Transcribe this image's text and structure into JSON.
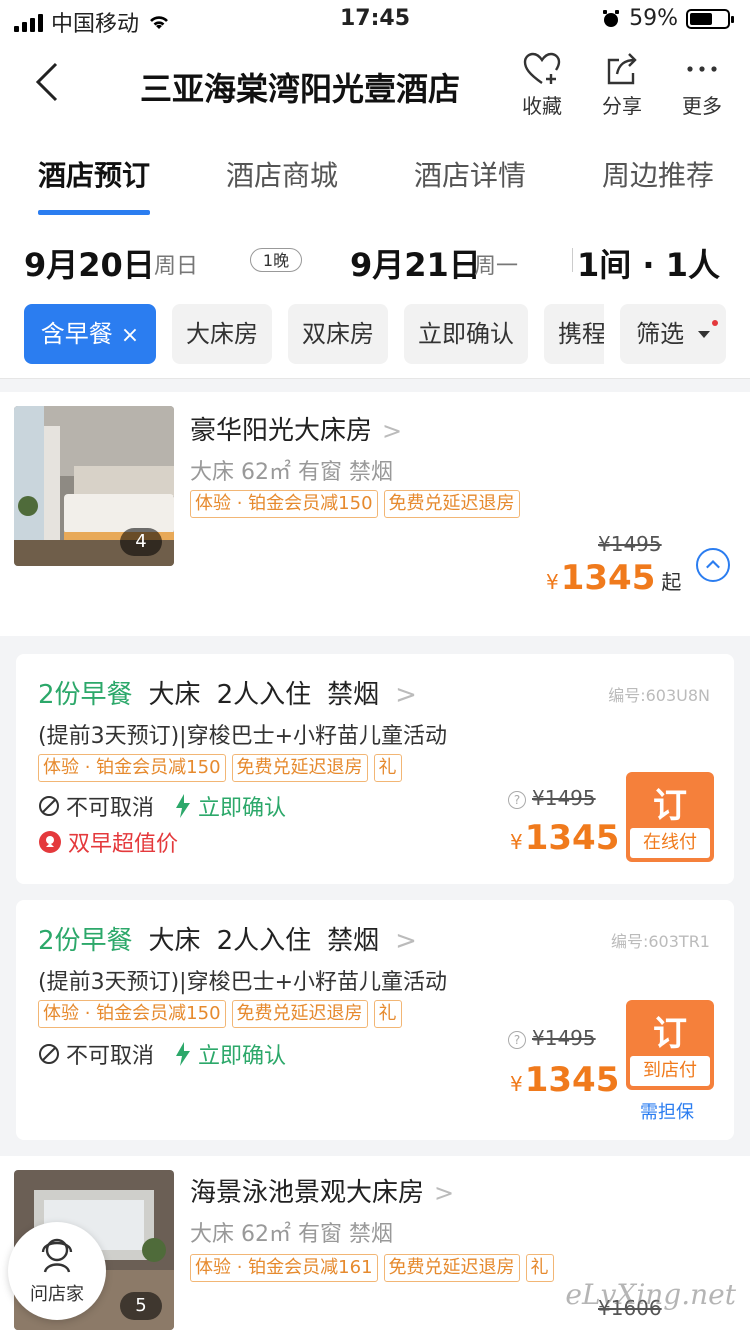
{
  "status": {
    "carrier": "中国移动",
    "time": "17:45",
    "battery": "59%"
  },
  "header": {
    "title": "三亚海棠湾阳光壹酒店",
    "actions": [
      {
        "label": "收藏",
        "icon": "heart-plus-icon"
      },
      {
        "label": "分享",
        "icon": "share-icon"
      },
      {
        "label": "更多",
        "icon": "more-dots-icon"
      }
    ]
  },
  "tabs": [
    {
      "label": "酒店预订",
      "active": true
    },
    {
      "label": "酒店商城"
    },
    {
      "label": "酒店详情"
    },
    {
      "label": "周边推荐"
    }
  ],
  "dates": {
    "checkin": "9月20日",
    "checkin_week": "周日",
    "nights": "1晚",
    "checkout": "9月21日",
    "checkout_week": "周一",
    "rooms": "1间 · 1人"
  },
  "filters": [
    {
      "label": "含早餐",
      "active": true,
      "close": "×"
    },
    {
      "label": "大床房"
    },
    {
      "label": "双床房"
    },
    {
      "label": "立即确认"
    },
    {
      "label": "携程"
    },
    {
      "label": "筛选"
    }
  ],
  "rooms": [
    {
      "name": "豪华阳光大床房",
      "attrs": "大床 62㎡  有窗 禁烟",
      "image_count": "4",
      "tags": [
        "体验 · 铂金会员减150",
        "免费兑延迟退房"
      ],
      "original_price": "¥1495",
      "currency": "¥",
      "price": "1345",
      "price_suffix": "起",
      "rates": [
        {
          "breakfast": "2份早餐",
          "bed": "大床",
          "guests": "2人入住",
          "smoking": "禁烟",
          "code": "编号:603U8N",
          "desc": "(提前3天预订)|穿梭巴士+小籽苗儿童活动",
          "tags": [
            "体验 · 铂金会员减150",
            "免费兑延迟退房",
            "礼"
          ],
          "cancel": "不可取消",
          "confirm": "立即确认",
          "deal": "双早超值价",
          "original_price": "¥1495",
          "currency": "¥",
          "price": "1345",
          "book": "订",
          "pay": "在线付"
        },
        {
          "breakfast": "2份早餐",
          "bed": "大床",
          "guests": "2人入住",
          "smoking": "禁烟",
          "code": "编号:603TR1",
          "desc": "(提前3天预订)|穿梭巴士+小籽苗儿童活动",
          "tags": [
            "体验 · 铂金会员减150",
            "免费兑延迟退房",
            "礼"
          ],
          "cancel": "不可取消",
          "confirm": "立即确认",
          "original_price": "¥1495",
          "currency": "¥",
          "price": "1345",
          "book": "订",
          "pay": "到店付",
          "guarantee": "需担保"
        }
      ]
    },
    {
      "name": "海景泳池景观大床房",
      "attrs": "大床 62㎡  有窗 禁烟",
      "image_count": "5",
      "tags": [
        "体验 · 铂金会员减161",
        "免费兑延迟退房",
        "礼"
      ],
      "original_price": "¥1606"
    }
  ],
  "fab": {
    "label": "问店家"
  },
  "watermark": "eLvXing.net",
  "colors": {
    "accent": "#2b7df0",
    "price": "#f07a1c",
    "green": "#2ca86a",
    "tag": "#e68a2e"
  }
}
